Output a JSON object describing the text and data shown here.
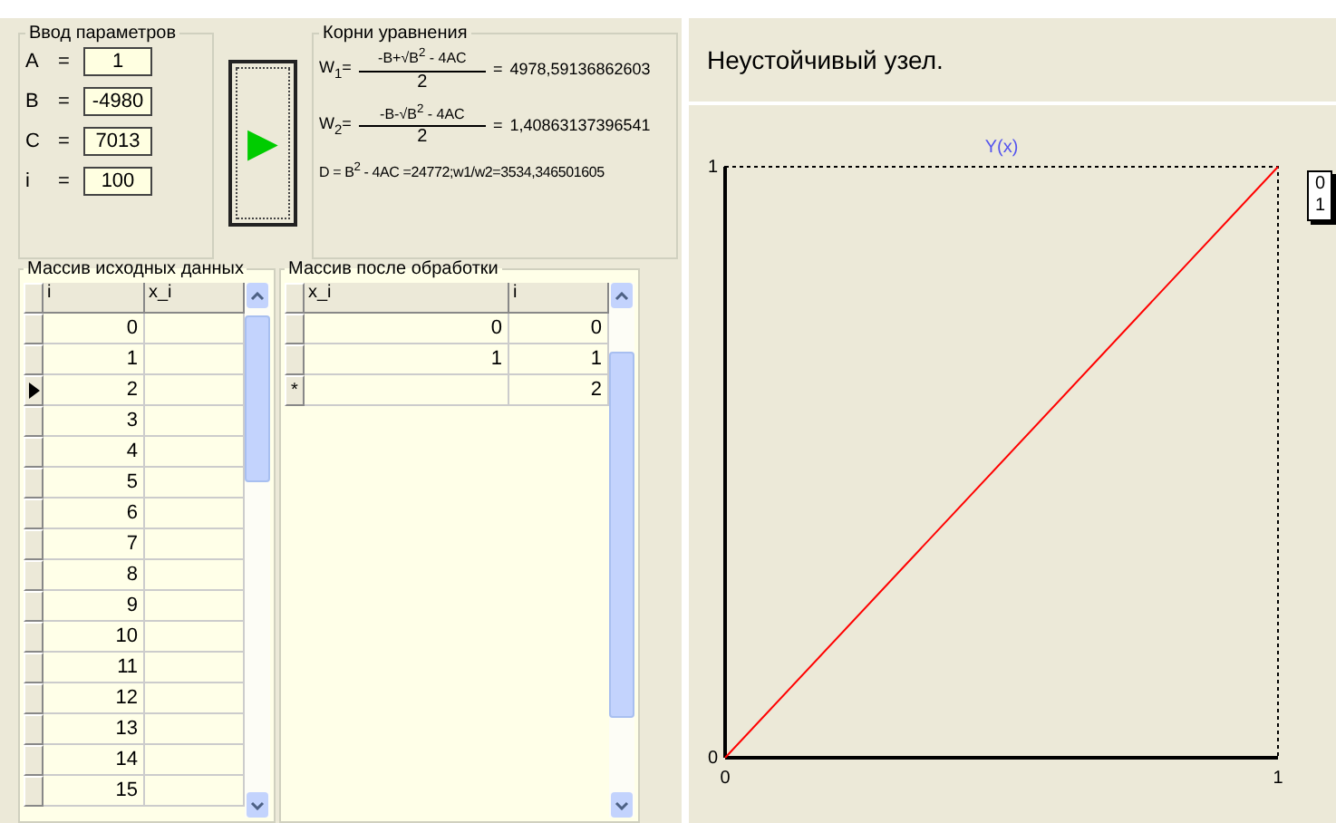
{
  "parameters": {
    "title": "Ввод параметров",
    "fields": [
      {
        "label": "A",
        "eq": "=",
        "value": "1"
      },
      {
        "label": "B",
        "eq": "=",
        "value": "-4980"
      },
      {
        "label": "C",
        "eq": "=",
        "value": "7013"
      },
      {
        "label": "i",
        "eq": "=",
        "value": "100"
      }
    ],
    "run_button": "▶"
  },
  "roots": {
    "title": "Корни уравнения",
    "formulas": [
      {
        "lhs": "W$_{1}$=",
        "numerator": "-B+√B$^{2}$ - 4AC",
        "denominator": "2",
        "eq": "=",
        "result": "4978,59136862603"
      },
      {
        "lhs": "W$_{2}$=",
        "numerator": "-B-√B$^{2}$ - 4AC",
        "denominator": "2",
        "eq": "=",
        "result": "1,40863137396541"
      }
    ],
    "discriminant": "D = B$^{2}$ - 4AC =24772;w1/w2=3534,346501605"
  },
  "source_table": {
    "title": "Массив исходных данных",
    "columns": [
      "i",
      "x_i"
    ],
    "rows": [
      {
        "selected": false,
        "cells": [
          "0",
          ""
        ]
      },
      {
        "selected": false,
        "cells": [
          "1",
          ""
        ]
      },
      {
        "selected": true,
        "cells": [
          "2",
          ""
        ]
      },
      {
        "selected": false,
        "cells": [
          "3",
          ""
        ]
      },
      {
        "selected": false,
        "cells": [
          "4",
          ""
        ]
      },
      {
        "selected": false,
        "cells": [
          "5",
          ""
        ]
      },
      {
        "selected": false,
        "cells": [
          "6",
          ""
        ]
      },
      {
        "selected": false,
        "cells": [
          "7",
          ""
        ]
      },
      {
        "selected": false,
        "cells": [
          "8",
          ""
        ]
      },
      {
        "selected": false,
        "cells": [
          "9",
          ""
        ]
      },
      {
        "selected": false,
        "cells": [
          "10",
          ""
        ]
      },
      {
        "selected": false,
        "cells": [
          "11",
          ""
        ]
      },
      {
        "selected": false,
        "cells": [
          "12",
          ""
        ]
      },
      {
        "selected": false,
        "cells": [
          "13",
          ""
        ]
      },
      {
        "selected": false,
        "cells": [
          "14",
          ""
        ]
      },
      {
        "selected": false,
        "cells": [
          "15",
          ""
        ]
      }
    ]
  },
  "result_table": {
    "title": "Массив после обработки",
    "columns": [
      "x_i",
      "i"
    ],
    "rows": [
      {
        "cells": [
          "0",
          "0"
        ]
      },
      {
        "cells": [
          "1",
          "1"
        ]
      },
      {
        "marker": "*",
        "cells": [
          "",
          "2"
        ]
      }
    ]
  },
  "chart_panel": {
    "title": "Неустойчивый узел.",
    "legend": [
      "0",
      "1"
    ],
    "chart_data": {
      "type": "line",
      "title": "Y(x)",
      "x": [
        0,
        1
      ],
      "series": [
        {
          "color": "#ff0000",
          "values": [
            0,
            1
          ]
        }
      ],
      "xlim": [
        0,
        1
      ],
      "ylim": [
        0,
        1
      ],
      "xticks": [
        0,
        1
      ],
      "yticks": [
        0,
        1
      ]
    }
  }
}
